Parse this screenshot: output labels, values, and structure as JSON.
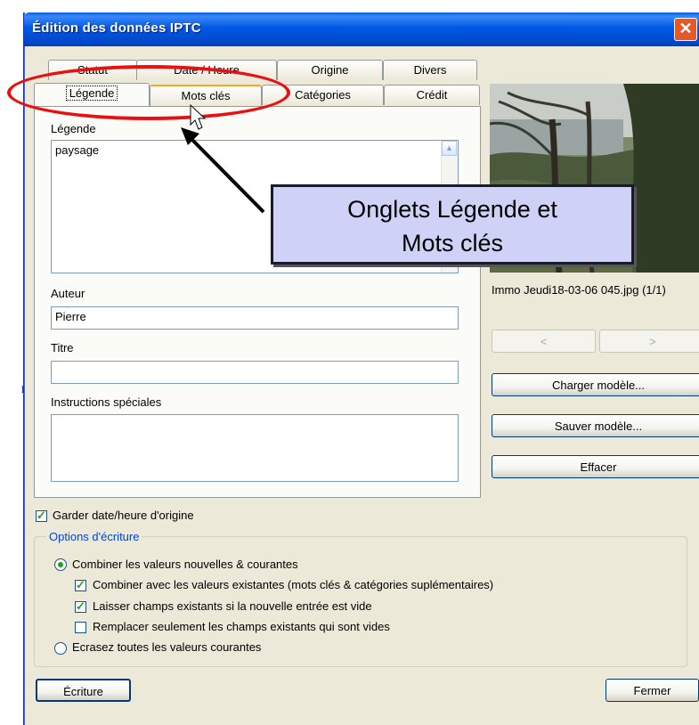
{
  "window": {
    "title": "Édition des données IPTC",
    "close_glyph": "✕"
  },
  "stray_text": [
    "t",
    "n"
  ],
  "tabs_row1": [
    "Statut",
    "Date / Heure",
    "Origine",
    "Divers"
  ],
  "tabs_row2": [
    "Légende",
    "Mots clés",
    "Catégories",
    "Crédit"
  ],
  "legend_tab": {
    "legende_label": "Légende",
    "legende_value": "paysage",
    "auteur_label": "Auteur",
    "auteur_value": "Pierre",
    "titre_label": "Titre",
    "titre_value": "",
    "instructions_label": "Instructions spéciales",
    "instructions_value": ""
  },
  "preview": {
    "filename": "Immo Jeudi18-03-06 045.jpg (1/1)",
    "prev_glyph": "<",
    "next_glyph": ">"
  },
  "buttons": {
    "charger": "Charger modèle...",
    "sauver": "Sauver modèle...",
    "effacer": "Effacer",
    "ecriture": "Écriture",
    "fermer": "Fermer"
  },
  "options": {
    "garder_label": "Garder date/heure d'origine",
    "garder_checked": true,
    "group_title": "Options d'écriture",
    "combiner_label": "Combiner les valeurs nouvelles & courantes",
    "combiner_selected": true,
    "combiner_existantes_label": "Combiner avec les valeurs existantes (mots clés & catégories suplémentaires)",
    "combiner_existantes_checked": true,
    "laisser_label": "Laisser champs existants si la nouvelle entrée est vide",
    "laisser_checked": true,
    "remplacer_label": "Remplacer seulement les champs existants qui sont vides",
    "remplacer_checked": false,
    "ecrasez_label": "Ecrasez toutes les valeurs courantes",
    "ecrasez_selected": false
  },
  "annotation": {
    "callout_line1": "Onglets Légende et",
    "callout_line2": "Mots clés",
    "highlight_color": "#e81010",
    "callout_bg": "#cfd2f6"
  }
}
